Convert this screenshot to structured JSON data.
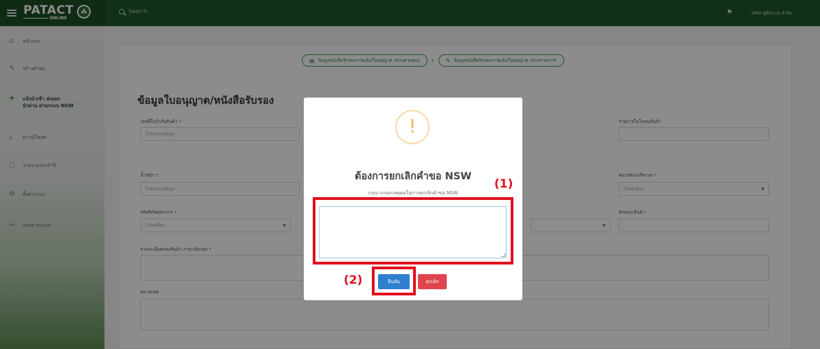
{
  "topbar": {
    "brand_main": "PATACT",
    "brand_sub": "ONLINE",
    "search_placeholder": "Search",
    "company": "บริษัท คู่มือระบบ จำกัด"
  },
  "sidebar": {
    "items": [
      {
        "label": "หน้าแรก",
        "icon": "home-icon",
        "glyph": "⌂"
      },
      {
        "label": "สร้างคำขอ",
        "icon": "pencil-icon",
        "glyph": "✎"
      },
      {
        "label": "แจ้งนำเข้า ส่งออก\nนำผ่าน ผ่านระบบ NSW",
        "icon": "airplane-icon",
        "glyph": "✈"
      },
      {
        "label": "ดาวน์โหลด",
        "icon": "download-icon",
        "glyph": "⤓"
      },
      {
        "label": "รายงานประจำปี",
        "icon": "document-icon",
        "glyph": "▢"
      },
      {
        "label": "ตั้งค่าระบบ",
        "icon": "gears-icon",
        "glyph": "⚙"
      },
      {
        "label": "ออกจากระบบ",
        "icon": "logout-icon",
        "glyph": "⇥"
      }
    ]
  },
  "stepper": {
    "step1": "ข้อมูลหนังสือรับรองการแจ้ง/ใบอนุญาต (ส่วนควบคุม)",
    "step2": "ข้อมูลหนังสือรับรองการแจ้ง/ใบอนุญาต (ส่วนรายการ)"
  },
  "form": {
    "title": "ข้อมูลใบอนุญาต/หนังสือรับรอง",
    "invoice_label": "เลขที่ใบกำกับสินค้า",
    "invoice_placeholder": "โปรดระบุข้อมูล",
    "items_label": "รายการในใบขนสินค้า",
    "weight_label": "น้ำหนัก",
    "weight_placeholder": "โปรดระบุข้อมูล",
    "unit_label": "หน่วยของปริมาณ",
    "unit_placeholder": "โปรดเลือก",
    "tariff_label": "รหัสพิกัดศุลกากร",
    "tariff_placeholder": "โปรดเลือก",
    "nature_label": "ลักษณะสินค้า",
    "desc_en_label": "รายละเอียดของสินค้า ภาษาอังกฤษ",
    "remark_label": "หมายเหตุ",
    "required_mark": "*"
  },
  "modal": {
    "title": "ต้องการยกเลิกคำขอ NSW",
    "subtitle": "กรุณากรอกเหตุผลในการยกเลิกคำขอ NSW",
    "confirm_label": "ยืนยัน",
    "cancel_label": "ยกเลิก",
    "warn_glyph": "!"
  },
  "annotations": {
    "a1": "(1)",
    "a2": "(2)"
  },
  "colors": {
    "brand_green": "#1e5a2a",
    "confirm_blue": "#2f7fd1",
    "cancel_red": "#e0454e",
    "annotation_red": "#e10f1e",
    "warning_orange": "#f3b55a"
  }
}
